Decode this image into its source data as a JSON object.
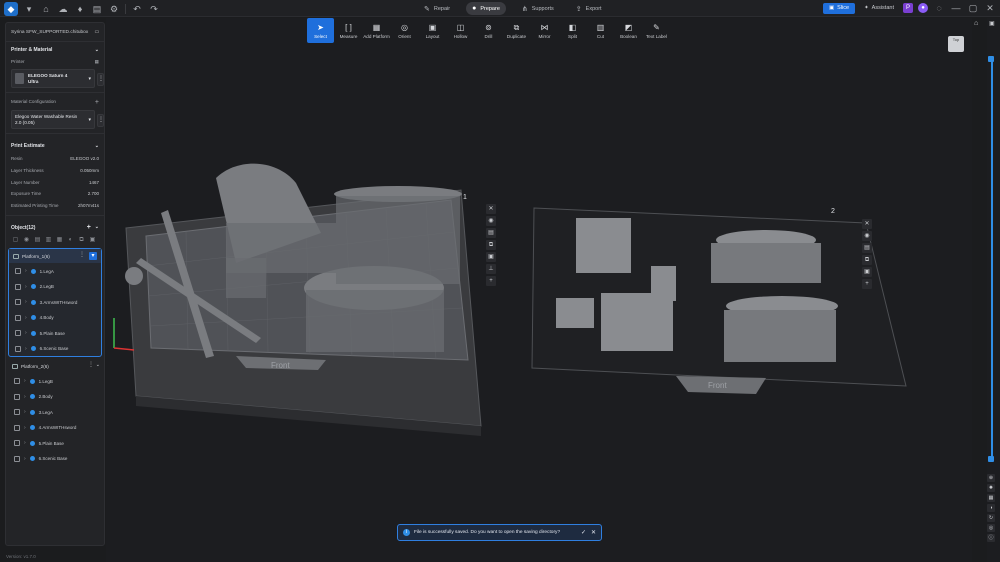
{
  "app": {
    "version": "Version: v1.7.0"
  },
  "topbar": {
    "tabs": [
      {
        "label": "Repair",
        "icon": "wrench-icon"
      },
      {
        "label": "Prepare",
        "icon": "prepare-icon"
      },
      {
        "label": "Supports",
        "icon": "supports-icon"
      },
      {
        "label": "Export",
        "icon": "export-icon"
      }
    ],
    "slice_label": "Slice",
    "assistant_label": "Assistant"
  },
  "sidebar": {
    "file_name": "Syrina SFW_SUPPORTED.chitubox",
    "printer_section": "Printer & Material",
    "printer_label": "Printer",
    "printer_name_1": "ELEGOO Saturn 4",
    "printer_name_2": "Ultra",
    "material_label": "Material Configuration",
    "material_1": "Elegoo Water Washable Resin",
    "material_2": "2.0 (0.05)",
    "estimate_section": "Print Estimate",
    "estimates": [
      {
        "label": "Resin",
        "value": "ELEGOO v2.0"
      },
      {
        "label": "Layer Thickness",
        "value": "0.050mm"
      },
      {
        "label": "Layer Number",
        "value": "1467"
      },
      {
        "label": "Exposure Time",
        "value": "2.700"
      },
      {
        "label": "Estimated Printing Time",
        "value": "2h07m41s"
      }
    ],
    "objects_label": "Object(12)",
    "platform1": {
      "name": "Platform_1(6)",
      "items": [
        "1.LegA",
        "2.LegB",
        "3.ArmsWITHsword",
        "4.Body",
        "5.Plain Base",
        "6.Scenic Base"
      ]
    },
    "platform2": {
      "name": "Platform_2(6)",
      "items": [
        "1.LegB",
        "2.Body",
        "3.LegA",
        "4.ArmsWITHsword",
        "5.Plain Base",
        "6.Scenic Base"
      ]
    }
  },
  "toolbar": [
    {
      "label": "Select",
      "icon": "cursor-icon"
    },
    {
      "label": "Measure",
      "icon": "measure-icon"
    },
    {
      "label": "Add Platform",
      "icon": "add-platform-icon"
    },
    {
      "label": "Orient",
      "icon": "orient-icon"
    },
    {
      "label": "Layout",
      "icon": "layout-icon"
    },
    {
      "label": "Hollow",
      "icon": "hollow-icon"
    },
    {
      "label": "Drill",
      "icon": "drill-icon"
    },
    {
      "label": "Duplicate",
      "icon": "duplicate-icon"
    },
    {
      "label": "Mirror",
      "icon": "mirror-icon"
    },
    {
      "label": "Split",
      "icon": "split-icon"
    },
    {
      "label": "Cut",
      "icon": "cut-icon"
    },
    {
      "label": "Boolean",
      "icon": "boolean-icon"
    },
    {
      "label": "Text Label",
      "icon": "text-label-icon"
    }
  ],
  "viewport": {
    "platform1_number": "1",
    "platform2_number": "2",
    "front_label": "Front",
    "view_cube_label": "Top"
  },
  "toast": {
    "message": "File is successfully saved. Do you want to open the saving directory?"
  }
}
